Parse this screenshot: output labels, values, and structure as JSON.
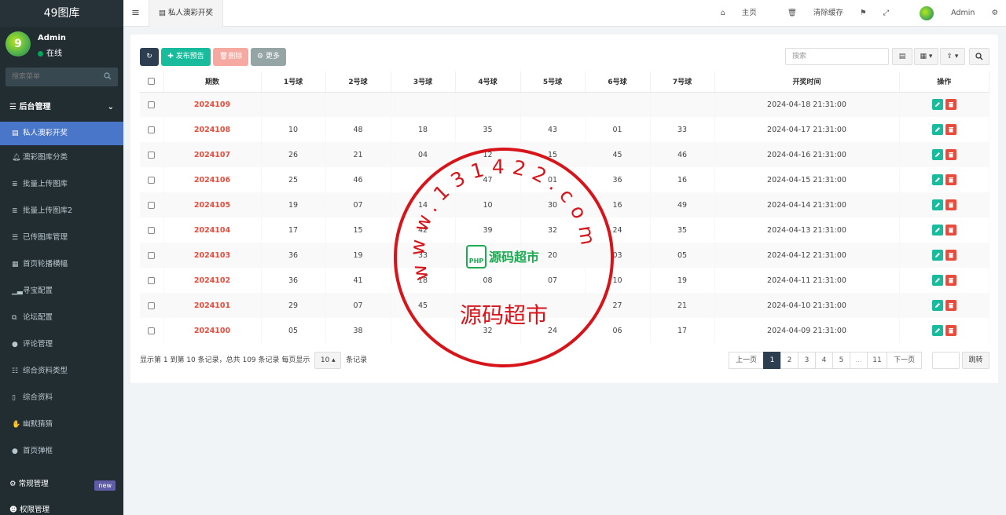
{
  "app": {
    "title": "49图库"
  },
  "user": {
    "name": "Admin",
    "status": "在线"
  },
  "sidebar": {
    "search_placeholder": "搜索菜单",
    "section_header": "后台管理",
    "items": [
      {
        "label": "私人澳彩开奖",
        "icon": "table-icon",
        "active": true
      },
      {
        "label": "澳彩图库分类",
        "icon": "bell-icon"
      },
      {
        "label": "批量上传图库",
        "icon": "database-icon"
      },
      {
        "label": "批量上传图库2",
        "icon": "database-icon"
      },
      {
        "label": "已传图库管理",
        "icon": "list-icon"
      },
      {
        "label": "首页轮播横幅",
        "icon": "windows-icon"
      },
      {
        "label": "寻宝配置",
        "icon": "signal-icon"
      },
      {
        "label": "论坛配置",
        "icon": "clone-icon"
      },
      {
        "label": "评论管理",
        "icon": "comments-icon"
      },
      {
        "label": "综合资料类型",
        "icon": "list-ul-icon"
      },
      {
        "label": "综合资料",
        "icon": "file-icon"
      },
      {
        "label": "幽默猜猜",
        "icon": "sign-language-icon"
      },
      {
        "label": "首页弹框",
        "icon": "comment-icon"
      }
    ],
    "footer_items": [
      {
        "label": "常规管理",
        "badge": "new"
      },
      {
        "label": "权限管理"
      }
    ]
  },
  "topbar": {
    "tab_label": "私人澳彩开奖",
    "home_label": "主页",
    "clear_cache_label": "清除缓存",
    "admin_label": "Admin"
  },
  "toolbar": {
    "add_label": "发布预告",
    "delete_label": "删除",
    "more_label": "更多",
    "search_placeholder": "搜索"
  },
  "table": {
    "headers": [
      "期数",
      "1号球",
      "2号球",
      "3号球",
      "4号球",
      "5号球",
      "6号球",
      "7号球",
      "开奖时间",
      "操作"
    ],
    "rows": [
      {
        "period": "2024109",
        "balls": [
          "",
          "",
          "",
          "",
          "",
          "",
          ""
        ],
        "time": "2024-04-18 21:31:00"
      },
      {
        "period": "2024108",
        "balls": [
          "10",
          "48",
          "18",
          "35",
          "43",
          "01",
          "33"
        ],
        "time": "2024-04-17 21:31:00"
      },
      {
        "period": "2024107",
        "balls": [
          "26",
          "21",
          "04",
          "12",
          "15",
          "45",
          "46"
        ],
        "time": "2024-04-16 21:31:00"
      },
      {
        "period": "2024106",
        "balls": [
          "25",
          "46",
          "",
          "47",
          "01",
          "36",
          "16"
        ],
        "time": "2024-04-15 21:31:00"
      },
      {
        "period": "2024105",
        "balls": [
          "19",
          "07",
          "14",
          "10",
          "30",
          "16",
          "49"
        ],
        "time": "2024-04-14 21:31:00"
      },
      {
        "period": "2024104",
        "balls": [
          "17",
          "15",
          "42",
          "39",
          "32",
          "24",
          "35"
        ],
        "time": "2024-04-13 21:31:00"
      },
      {
        "period": "2024103",
        "balls": [
          "36",
          "19",
          "33",
          "",
          "20",
          "03",
          "05"
        ],
        "time": "2024-04-12 21:31:00"
      },
      {
        "period": "2024102",
        "balls": [
          "36",
          "41",
          "18",
          "08",
          "07",
          "10",
          "19"
        ],
        "time": "2024-04-11 21:31:00"
      },
      {
        "period": "2024101",
        "balls": [
          "29",
          "07",
          "45",
          "",
          "",
          "27",
          "21"
        ],
        "time": "2024-04-10 21:31:00"
      },
      {
        "period": "2024100",
        "balls": [
          "05",
          "38",
          "",
          "32",
          "24",
          "06",
          "17"
        ],
        "time": "2024-04-09 21:31:00"
      }
    ]
  },
  "pagination": {
    "info_prefix": "显示第 1 到第 10 条记录，总共 109 条记录 每页显示",
    "page_size": "10",
    "info_suffix": "条记录",
    "prev_label": "上一页",
    "next_label": "下一页",
    "pages": [
      "1",
      "2",
      "3",
      "4",
      "5",
      "...",
      "11"
    ],
    "current_page": "1",
    "jump_label": "跳转"
  },
  "watermark": {
    "url_text": "www.131422.com",
    "name_text": "源码超市",
    "logo_text": "源码超市"
  },
  "colors": {
    "sidebar_bg": "#222d32",
    "active_item": "#4a76c9",
    "accent_green": "#18bc9c",
    "danger_red": "#e74c3c",
    "stamp_red": "#d7141a"
  }
}
